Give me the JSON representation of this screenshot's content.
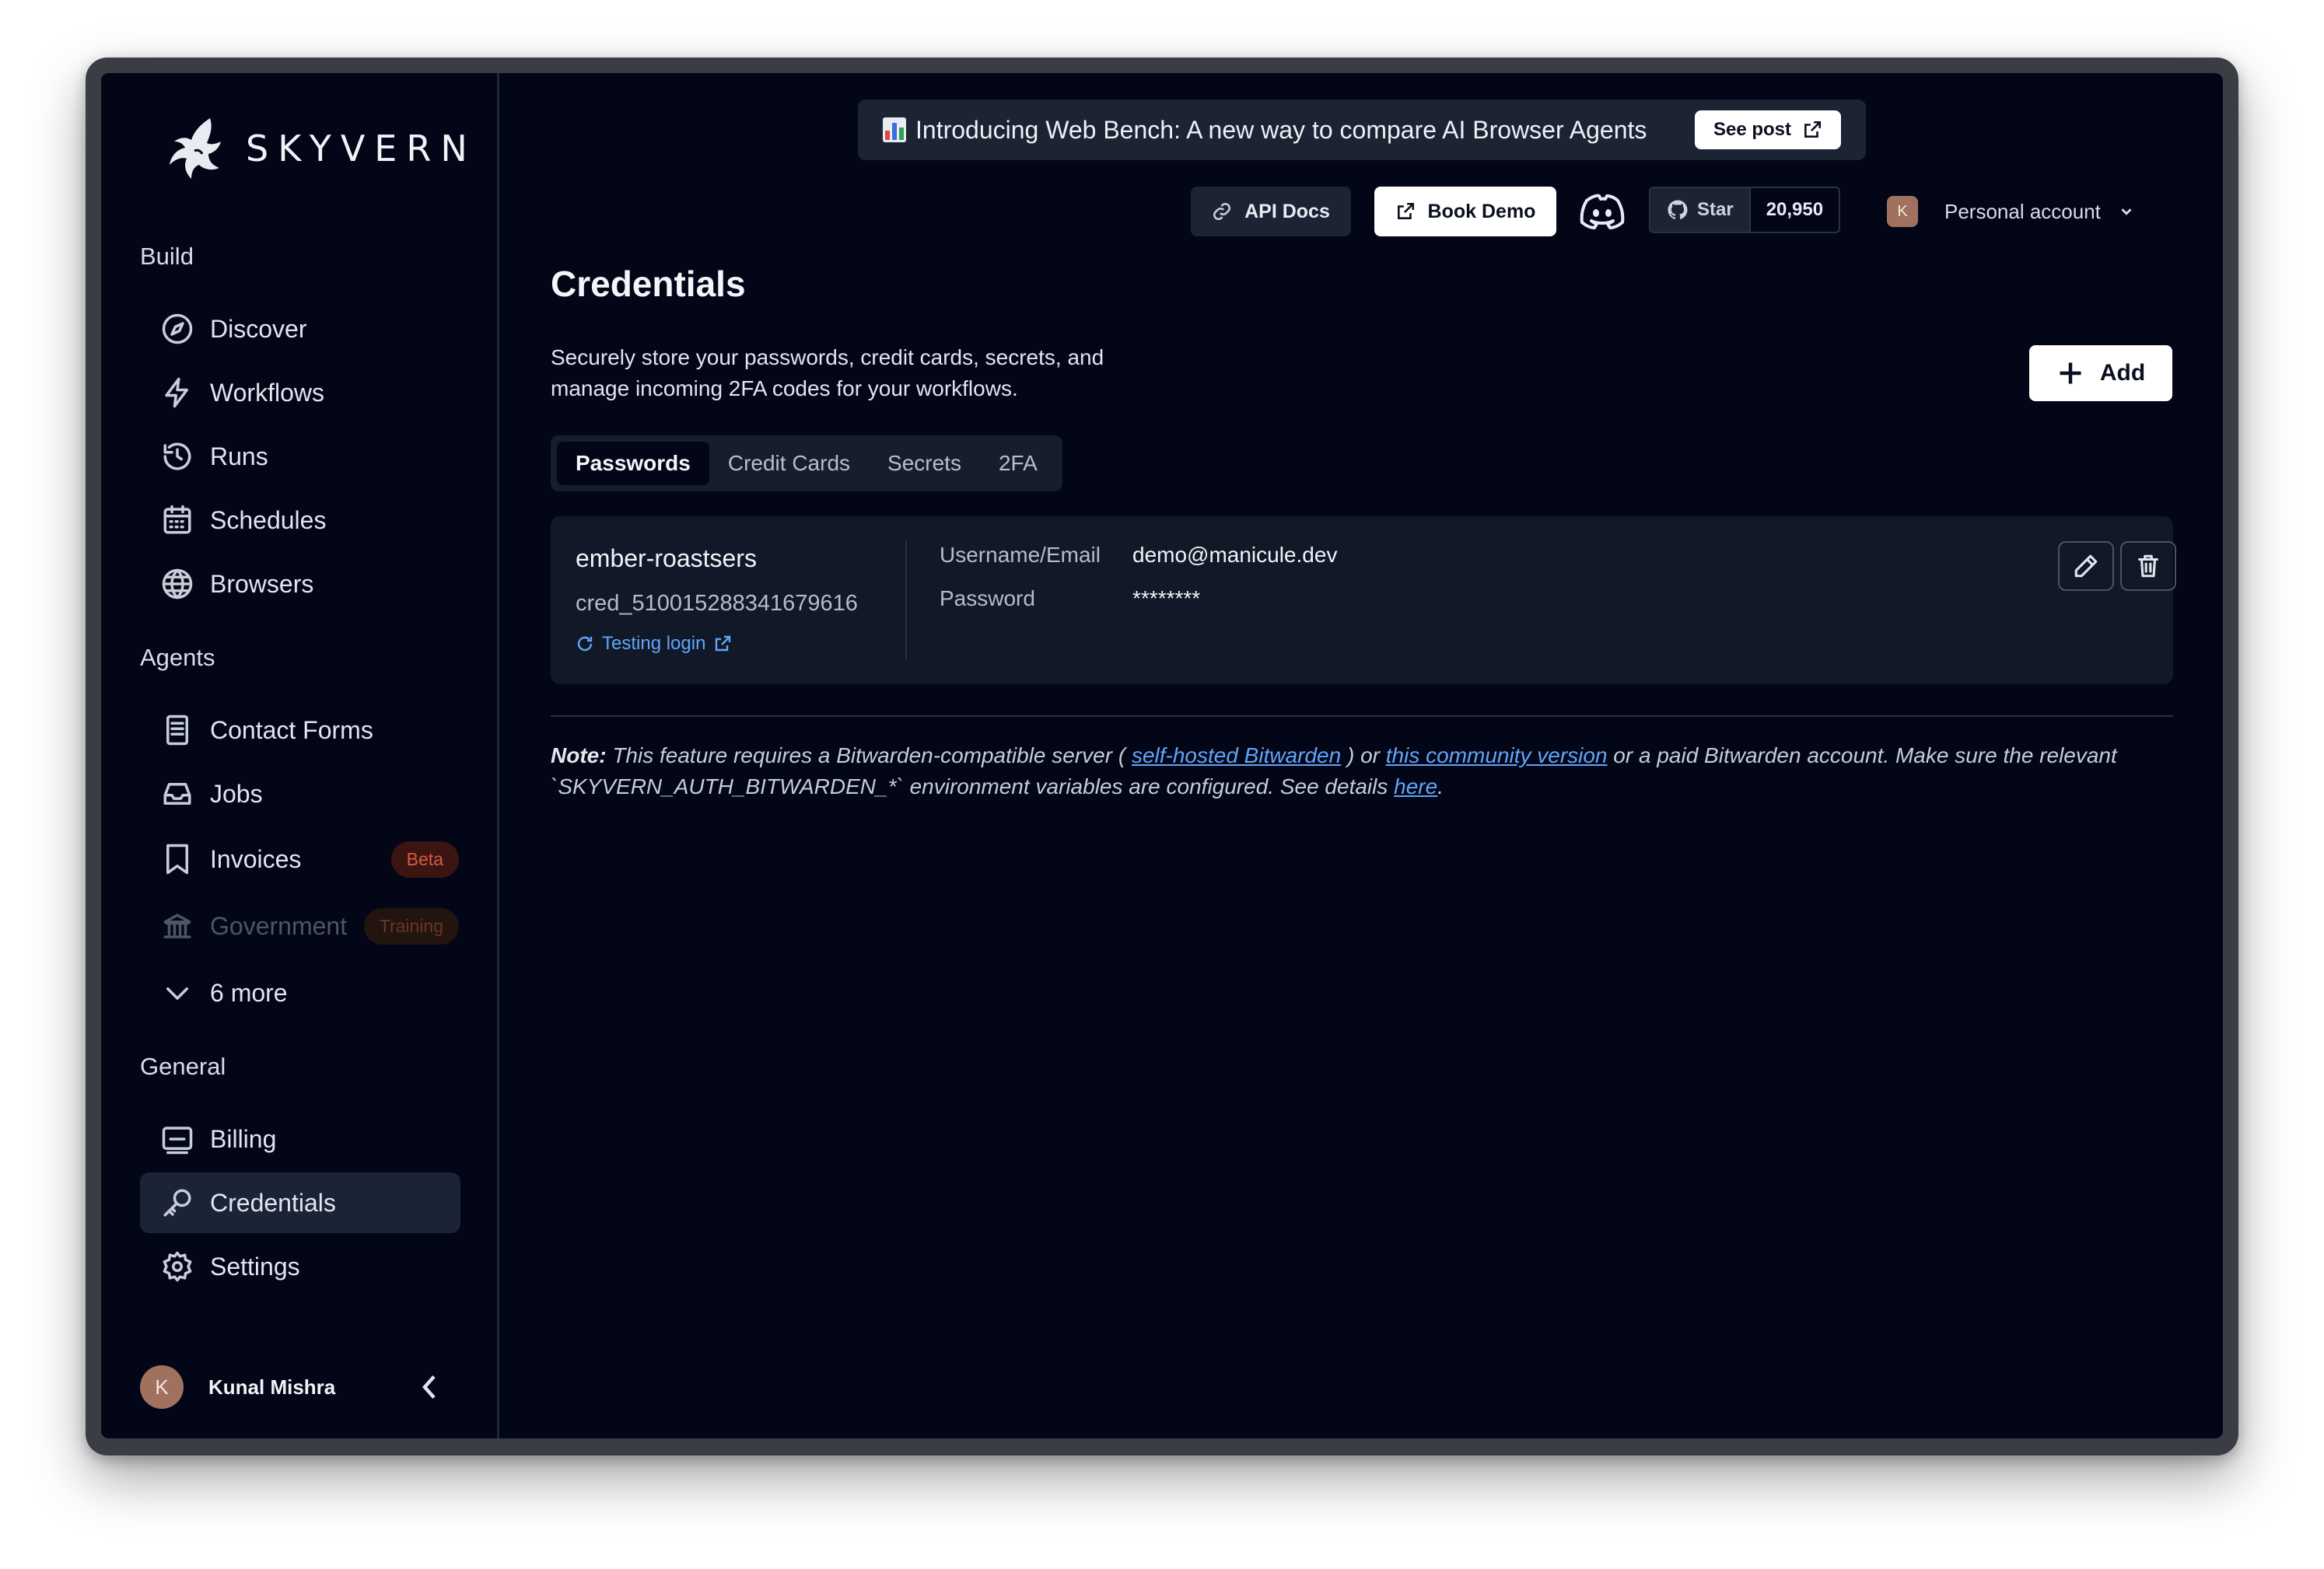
{
  "sidebar": {
    "logo_text": "SKYVERN",
    "sections": {
      "build": "Build",
      "agents": "Agents",
      "general": "General"
    },
    "build_items": [
      {
        "label": "Discover",
        "icon": "compass-icon"
      },
      {
        "label": "Workflows",
        "icon": "lightning-icon"
      },
      {
        "label": "Runs",
        "icon": "history-icon"
      },
      {
        "label": "Schedules",
        "icon": "calendar-icon"
      },
      {
        "label": "Browsers",
        "icon": "globe-icon"
      }
    ],
    "agent_items": [
      {
        "label": "Contact Forms",
        "icon": "form-icon"
      },
      {
        "label": "Jobs",
        "icon": "inbox-icon"
      },
      {
        "label": "Invoices",
        "icon": "receipt-icon",
        "badge": "Beta"
      },
      {
        "label": "Government",
        "icon": "bank-icon",
        "badge": "Training"
      },
      {
        "label": "6 more",
        "icon": "chevron-down-icon"
      }
    ],
    "general_items": [
      {
        "label": "Billing",
        "icon": "billing-icon"
      },
      {
        "label": "Credentials",
        "icon": "key-icon"
      },
      {
        "label": "Settings",
        "icon": "gear-icon"
      }
    ],
    "user": {
      "initial": "K",
      "name": "Kunal Mishra"
    }
  },
  "banner": {
    "text": "Introducing Web Bench: A new way to compare AI Browser Agents",
    "button": "See post"
  },
  "topbar": {
    "api_docs": "API Docs",
    "book_demo": "Book Demo",
    "github_star": "Star",
    "github_count": "20,950",
    "account_initial": "K",
    "account": "Personal account"
  },
  "page": {
    "title": "Credentials",
    "description": "Securely store your passwords, credit cards, secrets, and manage incoming 2FA codes for your workflows.",
    "add_button": "Add",
    "tabs": [
      "Passwords",
      "Credit Cards",
      "Secrets",
      "2FA"
    ],
    "active_tab": "Passwords"
  },
  "credential": {
    "name": "ember-roastsers",
    "id": "cred_510015288341679616",
    "status": "Testing login",
    "username_label": "Username/Email",
    "username": "demo@manicule.dev",
    "password_label": "Password",
    "password": "********"
  },
  "note": {
    "label": "Note:",
    "part1": " This feature requires a Bitwarden-compatible server ( ",
    "link1": "self-hosted Bitwarden",
    "part2": " ) or ",
    "link2": "this community version",
    "part3": " or a paid Bitwarden account. Make sure the relevant `SKYVERN_AUTH_BITWARDEN_*` environment variables are configured. See details ",
    "link3": "here",
    "part4": "."
  },
  "colors": {
    "background": "#020617",
    "card": "#111827",
    "accent_link": "#60a5fa",
    "beta_badge": "#d65a3e"
  }
}
